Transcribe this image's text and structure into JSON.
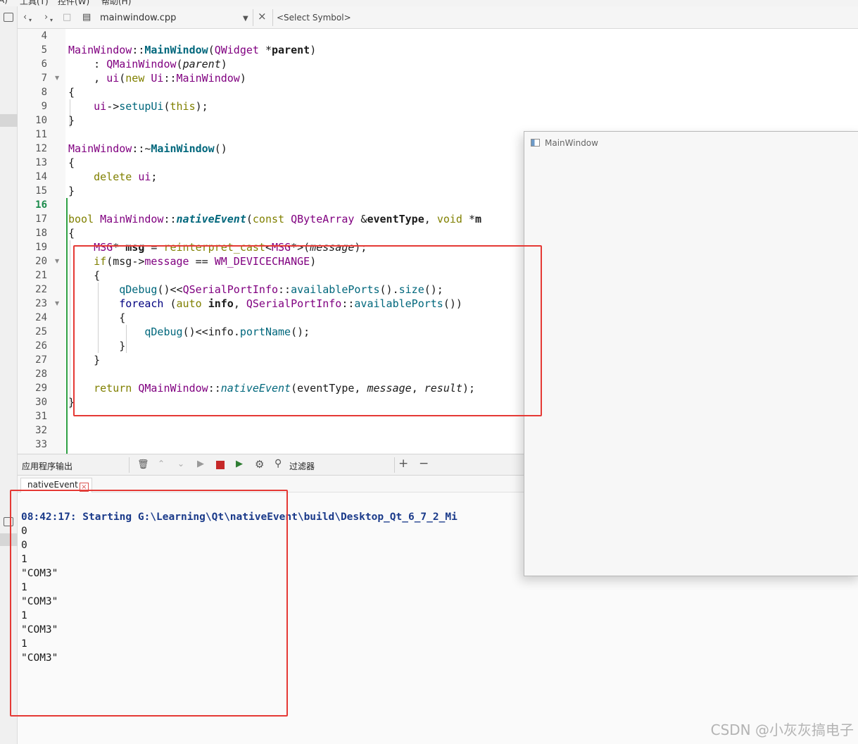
{
  "menu": [
    "A)",
    "工具(T)",
    "控件(W)",
    "帮助(H)"
  ],
  "toolbar": {
    "file_name": "mainwindow.cpp",
    "symbol_placeholder": "<Select Symbol>"
  },
  "editor": {
    "line_numbers": [
      "4",
      "5",
      "6",
      "7",
      "8",
      "9",
      "10",
      "11",
      "12",
      "13",
      "14",
      "15",
      "16",
      "17",
      "18",
      "19",
      "20",
      "21",
      "22",
      "23",
      "24",
      "25",
      "26",
      "27",
      "28",
      "29",
      "30",
      "31",
      "32",
      "33"
    ],
    "current_line": "16"
  },
  "code_tokens": {
    "l5": [
      "MainWindow",
      "::",
      "MainWindow",
      "(",
      "QWidget",
      " *",
      "parent",
      ")"
    ],
    "l6": [
      "    : ",
      "QMainWindow",
      "(",
      "parent",
      ")"
    ],
    "l7": [
      "    , ",
      "ui",
      "(",
      "new",
      " ",
      "Ui",
      "::",
      "MainWindow",
      ")"
    ],
    "l8": "{",
    "l9": [
      "    ",
      "ui",
      "->",
      "setupUi",
      "(",
      "this",
      ");"
    ],
    "l10": "}",
    "l12": [
      "MainWindow",
      "::~",
      "MainWindow",
      "()"
    ],
    "l13": "{",
    "l14": [
      "    ",
      "delete",
      " ",
      "ui",
      ";"
    ],
    "l15": "}",
    "l17": [
      "bool",
      " ",
      "MainWindow",
      "::",
      "nativeEvent",
      "(",
      "const",
      " ",
      "QByteArray",
      " &",
      "eventType",
      ", ",
      "void",
      " *",
      "m"
    ],
    "l18": "{",
    "l19": [
      "    ",
      "MSG",
      "* ",
      "msg",
      " = ",
      "reinterpret_cast",
      "<",
      "MSG",
      "*>(",
      "message",
      ");"
    ],
    "l20": [
      "    ",
      "if",
      "(",
      "msg",
      "->",
      "message",
      " == ",
      "WM_DEVICECHANGE",
      ")"
    ],
    "l21": "    {",
    "l22": [
      "        ",
      "qDebug",
      "()<<",
      "QSerialPortInfo",
      "::",
      "availablePorts",
      "().",
      "size",
      "();"
    ],
    "l23": [
      "        ",
      "foreach",
      " (",
      "auto",
      " ",
      "info",
      ", ",
      "QSerialPortInfo",
      "::",
      "availablePorts",
      "())"
    ],
    "l24": "        {",
    "l25": [
      "            ",
      "qDebug",
      "()<<",
      "info",
      ".",
      "portName",
      "();"
    ],
    "l26": "        }",
    "l27": "    }",
    "l29": [
      "    ",
      "return",
      " ",
      "QMainWindow",
      "::",
      "nativeEvent",
      "(",
      "eventType",
      ", ",
      "message",
      ", ",
      "result",
      ");"
    ],
    "l30": "}"
  },
  "output_pane": {
    "title": "应用程序输出",
    "filter_label": "过滤器",
    "plus": "+",
    "minus": "−",
    "tab_label": "nativeEvent",
    "tab_close": "×",
    "start_line": "08:42:17: Starting G:\\Learning\\Qt\\nativeEvent\\build\\Desktop_Qt_6_7_2_Mi",
    "lines": [
      "0",
      "0",
      "1",
      "\"COM3\"",
      "1",
      "\"COM3\"",
      "1",
      "\"COM3\"",
      "1",
      "\"COM3\""
    ]
  },
  "main_window": {
    "title": "MainWindow"
  },
  "watermark": "CSDN @小灰灰搞电子",
  "colors": {
    "annotation_red": "#e53935",
    "current_line_green": "#1a8a4a"
  }
}
